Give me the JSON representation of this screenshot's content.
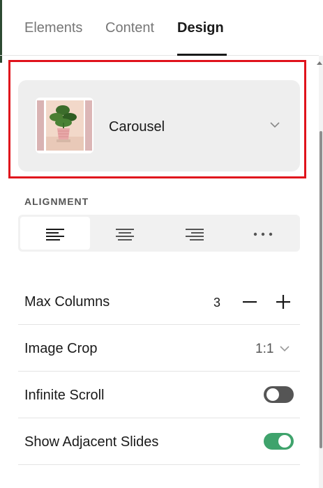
{
  "tabs": [
    {
      "label": "Elements",
      "active": false
    },
    {
      "label": "Content",
      "active": false
    },
    {
      "label": "Design",
      "active": true
    }
  ],
  "layout": {
    "name": "Carousel",
    "thumbnail_icon": "potted-plant-image",
    "highlight_color": "#e0131c"
  },
  "alignment": {
    "label": "ALIGNMENT",
    "options": [
      {
        "icon": "align-left-icon",
        "active": true
      },
      {
        "icon": "align-center-icon",
        "active": false
      },
      {
        "icon": "align-right-icon",
        "active": false
      },
      {
        "icon": "more-icon",
        "active": false
      }
    ]
  },
  "settings": {
    "max_columns": {
      "label": "Max Columns",
      "value": "3"
    },
    "image_crop": {
      "label": "Image Crop",
      "value": "1:1"
    },
    "infinite_scroll": {
      "label": "Infinite Scroll",
      "enabled": false
    },
    "adjacent_slides": {
      "label": "Show Adjacent Slides",
      "enabled": true
    }
  },
  "colors": {
    "toggle_on": "#3fa36c",
    "toggle_off": "#555555"
  }
}
